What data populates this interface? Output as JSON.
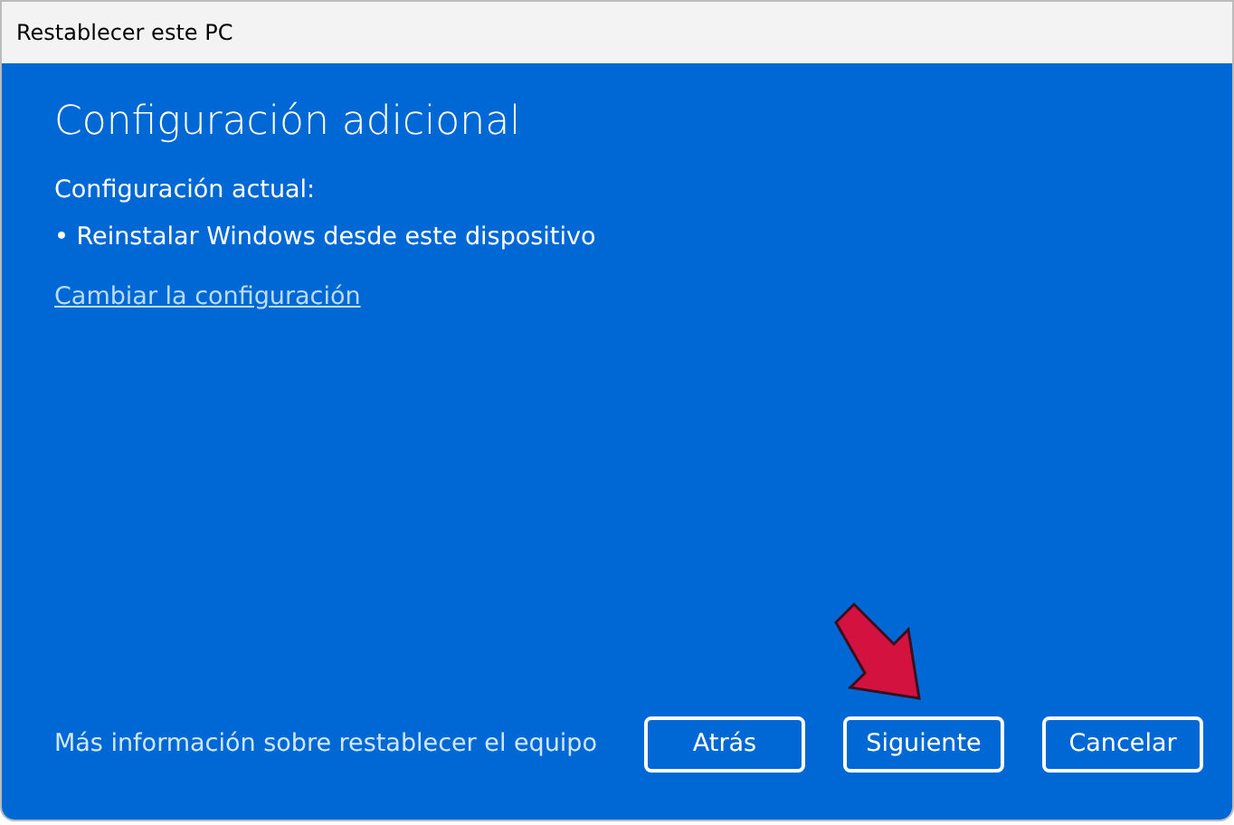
{
  "window": {
    "title": "Restablecer este PC"
  },
  "heading": "Configuración adicional",
  "settings_label": "Configuración actual:",
  "settings_items": [
    "• Reinstalar Windows desde este dispositivo"
  ],
  "change_link": "Cambiar la configuración",
  "footer_link": "Más información sobre restablecer el equipo",
  "buttons": [
    {
      "label": "Atrás"
    },
    {
      "label": "Siguiente"
    },
    {
      "label": "Cancelar"
    }
  ],
  "annotation": {
    "kind": "arrow",
    "color": "#d3123f"
  }
}
